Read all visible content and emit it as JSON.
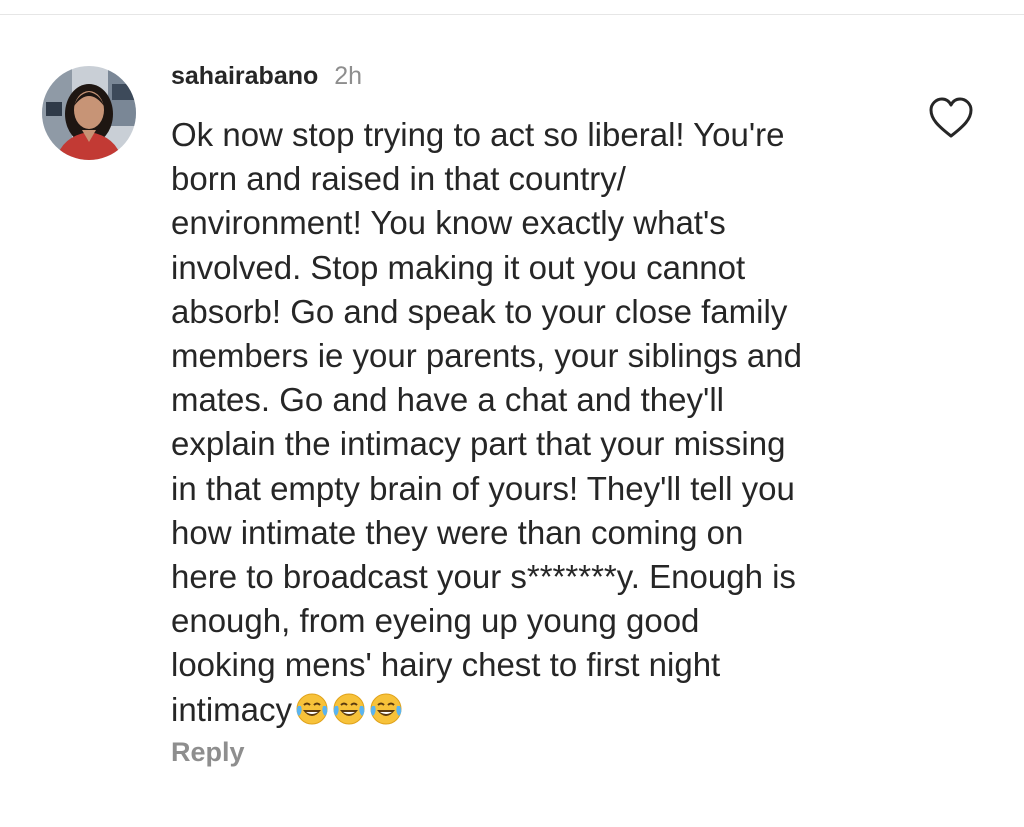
{
  "comment": {
    "username": "sahairabano",
    "time": "2h",
    "text_lines": [
      "Ok now stop trying to act so liberal! You're",
      "born and raised in that country/",
      "environment! You know exactly what's",
      "involved. Stop making it out you cannot",
      "absorb! Go and speak to your close family",
      "members ie your parents, your siblings and",
      "mates. Go and have a chat and they'll",
      "explain the intimacy part that your missing",
      "in that empty brain of yours! They'll tell you",
      "how intimate they were than coming on",
      "here to broadcast your s*******y. Enough is",
      "enough, from eyeing up young good",
      "looking mens' hairy chest to first night",
      "intimacy"
    ],
    "trailing_emoji": [
      "😂",
      "😂",
      "😂"
    ],
    "reply_label": "Reply"
  },
  "icons": {
    "like": "heart-outline-icon",
    "emoji": "face-with-tears-of-joy"
  },
  "colors": {
    "text": "#262626",
    "secondary": "#8e8e8e",
    "background": "#ffffff"
  }
}
